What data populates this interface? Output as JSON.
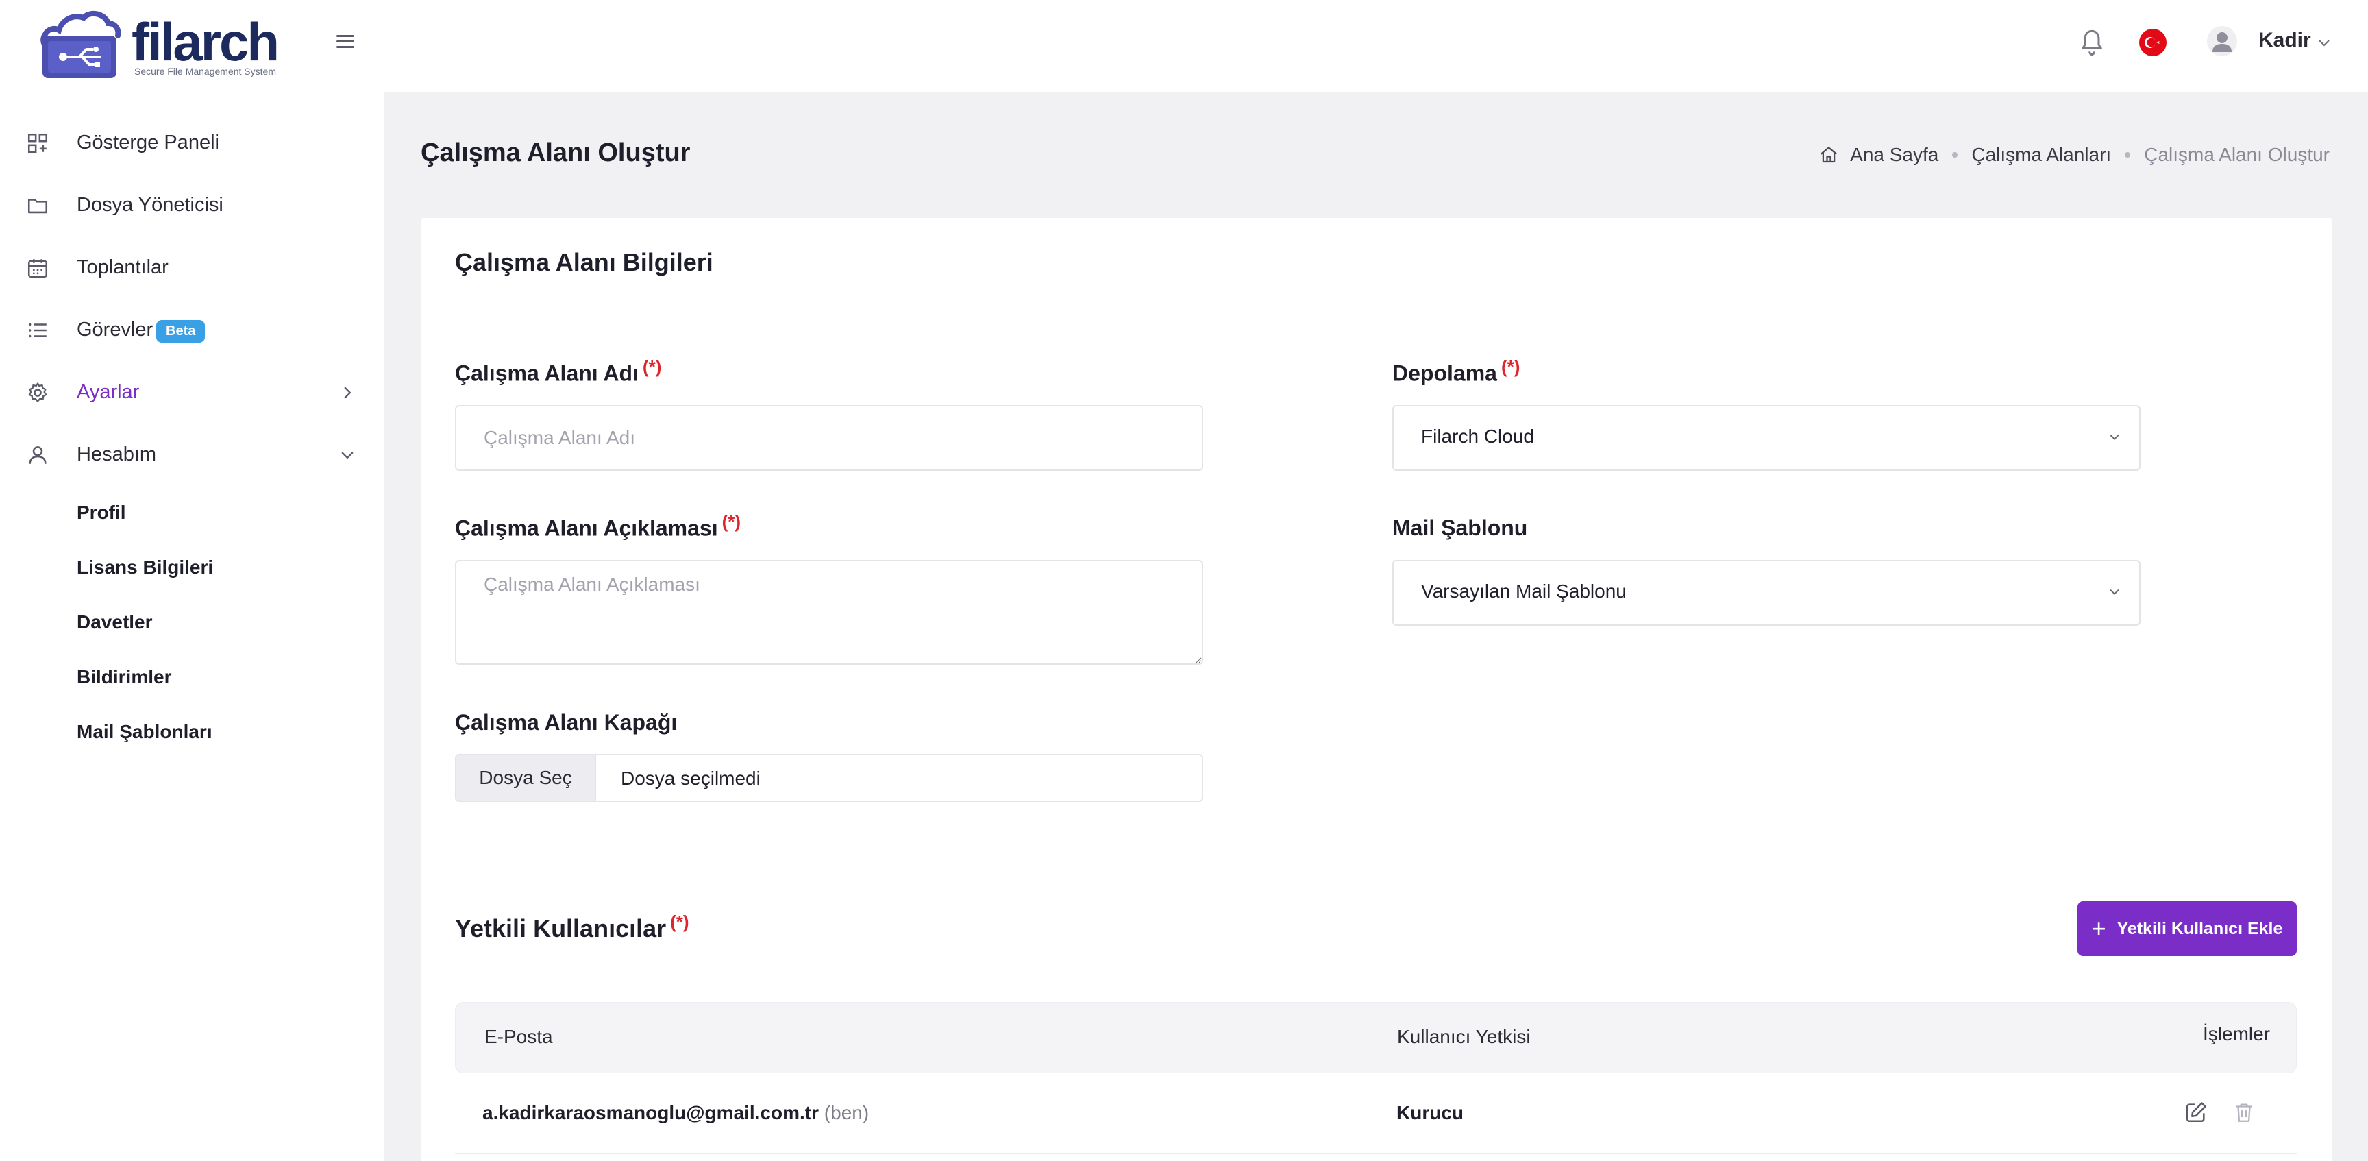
{
  "header": {
    "logo_text": "filarch",
    "logo_tagline": "Secure File Management System",
    "user_name": "Kadir"
  },
  "sidebar": {
    "items": [
      {
        "label": "Gösterge Paneli"
      },
      {
        "label": "Dosya Yöneticisi"
      },
      {
        "label": "Toplantılar"
      },
      {
        "label": "Görevler",
        "badge": "Beta"
      },
      {
        "label": "Ayarlar"
      },
      {
        "label": "Hesabım"
      }
    ],
    "account_subitems": [
      "Profil",
      "Lisans Bilgileri",
      "Davetler",
      "Bildirimler",
      "Mail Şablonları"
    ]
  },
  "page": {
    "title": "Çalışma Alanı Oluştur",
    "breadcrumb": [
      "Ana Sayfa",
      "Çalışma Alanları",
      "Çalışma Alanı Oluştur"
    ]
  },
  "form": {
    "section_title": "Çalışma Alanı Bilgileri",
    "required_mark": "(*)",
    "name_label": "Çalışma Alanı Adı",
    "name_placeholder": "Çalışma Alanı Adı",
    "description_label": "Çalışma Alanı Açıklaması",
    "description_placeholder": "Çalışma Alanı Açıklaması",
    "cover_label": "Çalışma Alanı Kapağı",
    "file_button": "Dosya Seç",
    "file_status": "Dosya seçilmedi",
    "storage_label": "Depolama",
    "storage_value": "Filarch Cloud",
    "mail_template_label": "Mail Şablonu",
    "mail_template_value": "Varsayılan Mail Şablonu"
  },
  "authorized_users": {
    "title": "Yetkili Kullanıcılar",
    "add_button": "Yetkili Kullanıcı Ekle",
    "columns": [
      "E-Posta",
      "Kullanıcı Yetkisi",
      "İşlemler"
    ],
    "rows": [
      {
        "email": "a.kadirkaraosmanoglu@gmail.com.tr",
        "suffix": "(ben)",
        "role": "Kurucu"
      }
    ]
  },
  "colors": {
    "accent": "#7a2ec7",
    "required": "#e0242e",
    "beta_badge": "#3aa0e6"
  }
}
